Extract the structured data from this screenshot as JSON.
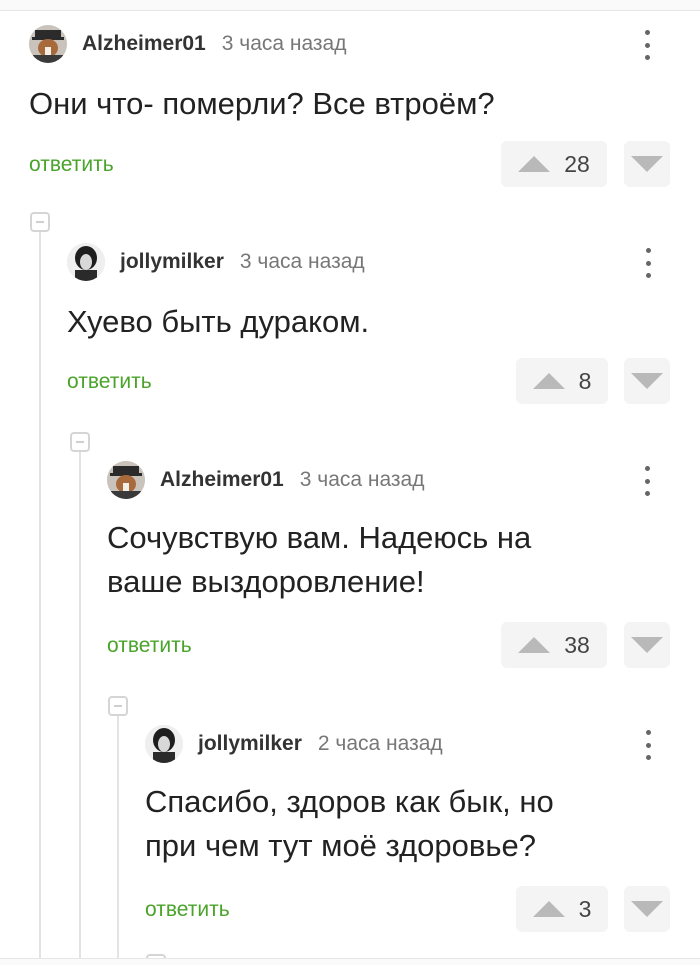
{
  "colors": {
    "reply": "#4aa32a",
    "thread_line": "#e3e3e3",
    "vote_bg": "#f4f4f4"
  },
  "comments": [
    {
      "author": "Alzheimer01",
      "time": "3 часа назад",
      "text": "Они что- померли? Все втроём?",
      "reply": "ответить",
      "rating": "28",
      "avatar": "dog-avatar"
    },
    {
      "author": "jollymilker",
      "time": "3 часа назад",
      "text": "Хуево быть дураком.",
      "reply": "ответить",
      "rating": "8",
      "avatar": "person-avatar"
    },
    {
      "author": "Alzheimer01",
      "time": "3 часа назад",
      "text_lines": [
        "Сочувствую вам. Надеюсь на",
        "ваше выздоровление!"
      ],
      "reply": "ответить",
      "rating": "38",
      "avatar": "dog-avatar"
    },
    {
      "author": "jollymilker",
      "time": "2 часа назад",
      "text_lines": [
        "Спасибо, здоров как бык, но",
        "при чем тут моё здоровье?"
      ],
      "reply": "ответить",
      "rating": "3",
      "avatar": "person-avatar"
    }
  ]
}
